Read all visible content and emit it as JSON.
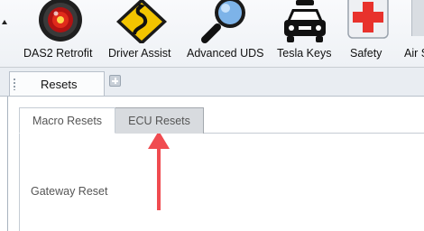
{
  "ribbon": {
    "buttons": [
      {
        "label": "DAS2 Retrofit",
        "icon": "red-eye-icon"
      },
      {
        "label": "Driver Assist",
        "icon": "winding-road-sign-icon"
      },
      {
        "label": "Advanced UDS",
        "icon": "magnifier-icon"
      },
      {
        "label": "Tesla Keys",
        "icon": "car-icon"
      },
      {
        "label": "Safety",
        "icon": "first-aid-icon"
      },
      {
        "label": "Air S",
        "icon": "air-suspension-icon"
      }
    ]
  },
  "doc_tabs": {
    "active_label": "Resets"
  },
  "sub_tabs": {
    "items": [
      {
        "label": "Macro Resets",
        "state": "active"
      },
      {
        "label": "ECU Resets",
        "state": "inactive"
      }
    ]
  },
  "panel": {
    "field_label": "Gateway Reset"
  },
  "colors": {
    "annotation_arrow": "#f04b50",
    "sign_yellow": "#f3c400",
    "eye_red": "#d91c1c",
    "cross_red": "#e8322c"
  }
}
